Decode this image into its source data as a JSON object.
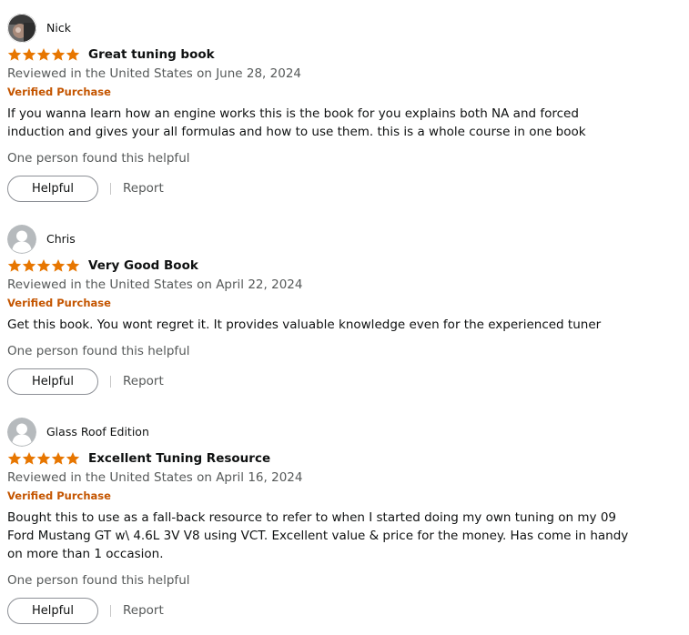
{
  "colors": {
    "star": "#e77600",
    "verified": "#c45500",
    "muted_text": "#565959",
    "text": "#0f1111"
  },
  "reviews": [
    {
      "author": "Nick",
      "avatar": "profile-photo",
      "rating": 5,
      "title": "Great tuning book",
      "date": "Reviewed in the United States on June 28, 2024",
      "verified": "Verified Purchase",
      "body": "If you wanna learn how an engine works this is the book for you explains both NA and forced induction and gives your all formulas and how to use them. this is a whole course in one book",
      "helpful_count": "One person found this helpful",
      "helpful_label": "Helpful",
      "report_label": "Report"
    },
    {
      "author": "Chris",
      "avatar": "default-avatar",
      "rating": 5,
      "title": "Very Good Book",
      "date": "Reviewed in the United States on April 22, 2024",
      "verified": "Verified Purchase",
      "body": "Get this book. You wont regret it. It provides valuable knowledge even for the experienced tuner",
      "helpful_count": "One person found this helpful",
      "helpful_label": "Helpful",
      "report_label": "Report"
    },
    {
      "author": "Glass Roof Edition",
      "avatar": "default-avatar",
      "rating": 5,
      "title": "Excellent Tuning Resource",
      "date": "Reviewed in the United States on April 16, 2024",
      "verified": "Verified Purchase",
      "body": "Bought this to use as a fall-back resource to refer to when I started doing my own tuning on my 09 Ford Mustang GT w\\ 4.6L 3V V8 using VCT. Excellent value & price for the money. Has come in handy on more than 1 occasion.",
      "helpful_count": "One person found this helpful",
      "helpful_label": "Helpful",
      "report_label": "Report"
    }
  ]
}
